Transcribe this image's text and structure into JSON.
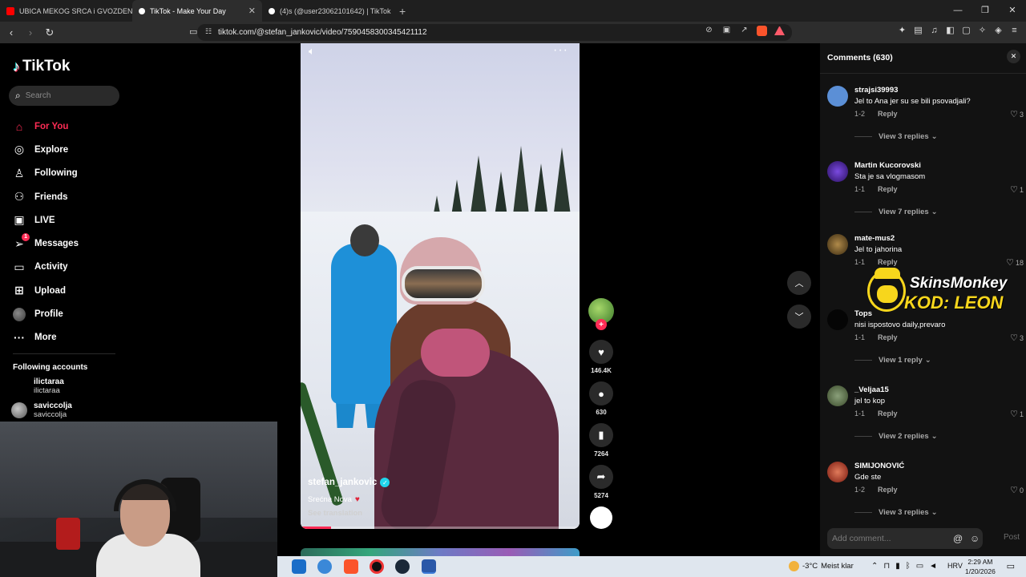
{
  "browser": {
    "tabs": [
      {
        "title": "UBICA MEKOG SRCA i GVOZDENE PE",
        "favicon": "youtube-icon",
        "color": "#ff0000"
      },
      {
        "title": "TikTok - Make Your Day",
        "favicon": "tiktok-icon",
        "color": "#ffffff",
        "active": true
      },
      {
        "title": "(4)s (@user23062101642) | TikTok",
        "favicon": "tiktok-icon",
        "color": "#ffffff"
      }
    ],
    "new_tab": "+",
    "url": "tiktok.com/@stefan_jankovic/video/7590458300345421112"
  },
  "sidebar": {
    "logo": "TikTok",
    "search_placeholder": "Search",
    "menu": [
      {
        "label": "For You",
        "icon": "home-icon",
        "active": true
      },
      {
        "label": "Explore",
        "icon": "compass-icon"
      },
      {
        "label": "Following",
        "icon": "user-check-icon"
      },
      {
        "label": "Friends",
        "icon": "users-icon"
      },
      {
        "label": "LIVE",
        "icon": "live-icon"
      },
      {
        "label": "Messages",
        "icon": "send-icon",
        "badge": "1"
      },
      {
        "label": "Activity",
        "icon": "activity-icon"
      },
      {
        "label": "Upload",
        "icon": "upload-icon"
      },
      {
        "label": "Profile",
        "icon": "avatar-icon"
      },
      {
        "label": "More",
        "icon": "more-icon"
      }
    ],
    "following_title": "Following accounts",
    "following": [
      {
        "name": "ilictaraa",
        "handle": "ilictaraa"
      },
      {
        "name": "saviccolja",
        "handle": "saviccolja"
      }
    ]
  },
  "video": {
    "author": "stefan_jankovic",
    "description": "Srećna Nova",
    "see_translation": "See translation",
    "progress": 0.11
  },
  "actions": {
    "likes": "146.4K",
    "comments": "630",
    "saves": "7264",
    "shares": "5274"
  },
  "comments_panel": {
    "title": "Comments (630)",
    "items": [
      {
        "user": "strajsi39993",
        "text": "Jel to Ana jer su se bili psovadjali?",
        "date": "1-2",
        "reply": "Reply",
        "likes": "3",
        "views": "View 3 replies",
        "avatar": "#5b8fd6"
      },
      {
        "user": "Martin Kucorovski",
        "text": "Sta je sa vlogmasom",
        "date": "1-1",
        "reply": "Reply",
        "likes": "1",
        "views": "View 7 replies",
        "avatar": "#6a3cc4"
      },
      {
        "user": "mate-mus2",
        "text": "Jel to jahorina",
        "date": "1-1",
        "reply": "Reply",
        "likes": "18",
        "views": "",
        "avatar": "#8a6a3a"
      },
      {
        "user": "Tops",
        "text": "nisi ispostovo daily,prevaro",
        "date": "1-1",
        "reply": "Reply",
        "likes": "3",
        "views": "View 1 reply",
        "avatar": "#050505"
      },
      {
        "user": "_Veljaa15",
        "text": "jel to kop",
        "date": "1-1",
        "reply": "Reply",
        "likes": "1",
        "views": "View 2 replies",
        "avatar": "#5a7a4a"
      },
      {
        "user": "SIMIJONOVIĆ",
        "text": "Gde ste",
        "date": "1-2",
        "reply": "Reply",
        "likes": "0",
        "views": "View 3 replies",
        "avatar": "#c4402a"
      }
    ],
    "input_placeholder": "Add comment...",
    "post": "Post"
  },
  "sponsor": {
    "brand": "SkinsMonkey",
    "code": "KOD: LEON"
  },
  "taskbar": {
    "temperature": "-3°C",
    "weather": "Meist klar",
    "language": "HRV",
    "time": "2:29 AM",
    "date": "1/20/2026"
  }
}
